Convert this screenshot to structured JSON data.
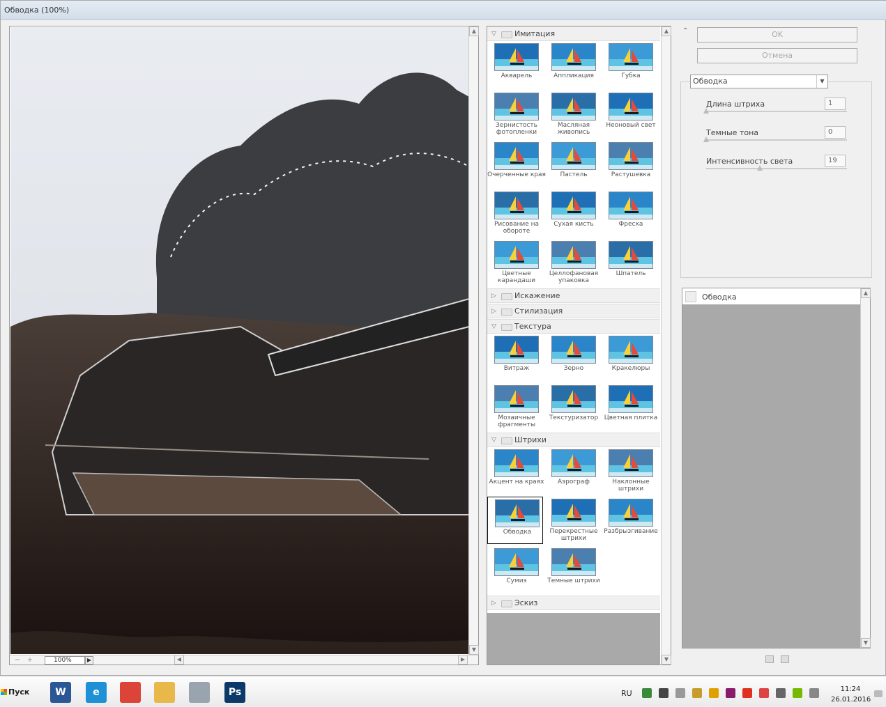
{
  "window": {
    "title": "Обводка (100%)"
  },
  "preview": {
    "zoom": "100%",
    "zoom_minus": "−",
    "zoom_plus": "+"
  },
  "gallery": {
    "categories": [
      {
        "name": "Имитация",
        "expanded": true,
        "filters": [
          "Акварель",
          "Аппликация",
          "Губка",
          "Зернистость фотопленки",
          "Масляная живопись",
          "Неоновый свет",
          "Очерченные края",
          "Пастель",
          "Растушевка",
          "Рисование на обороте",
          "Сухая кисть",
          "Фреска",
          "Цветные карандаши",
          "Целлофановая упаковка",
          "Шпатель"
        ]
      },
      {
        "name": "Искажение",
        "expanded": false,
        "filters": []
      },
      {
        "name": "Стилизация",
        "expanded": false,
        "filters": []
      },
      {
        "name": "Текстура",
        "expanded": true,
        "filters": [
          "Витраж",
          "Зерно",
          "Кракелюры",
          "Мозаичные фрагменты",
          "Текстуризатор",
          "Цветная плитка"
        ]
      },
      {
        "name": "Штрихи",
        "expanded": true,
        "filters": [
          "Акцент на краях",
          "Аэрограф",
          "Наклонные штрихи",
          "Обводка",
          "Перекрестные штрихи",
          "Разбрызгивание",
          "Сумиэ",
          "Темные штрихи"
        ]
      },
      {
        "name": "Эскиз",
        "expanded": false,
        "filters": []
      }
    ],
    "selected": "Обводка"
  },
  "buttons": {
    "ok": "OK",
    "cancel": "Отмена"
  },
  "settings": {
    "filter": "Обводка",
    "params": [
      {
        "label": "Длина штриха",
        "value": "1",
        "min": 1,
        "max": 50,
        "num": 1
      },
      {
        "label": "Темные тона",
        "value": "0",
        "min": 0,
        "max": 50,
        "num": 0
      },
      {
        "label": "Интенсивность света",
        "value": "19",
        "min": 0,
        "max": 50,
        "num": 19
      }
    ]
  },
  "layers": {
    "items": [
      "Обводка"
    ]
  },
  "taskbar": {
    "start": "Пуск",
    "apps": [
      {
        "name": "word",
        "label": "W",
        "color": "#2b5797"
      },
      {
        "name": "ie",
        "label": "e",
        "color": "#1e90d6"
      },
      {
        "name": "chrome",
        "label": "",
        "color": "#db4437"
      },
      {
        "name": "explorer",
        "label": "",
        "color": "#e8b94a"
      },
      {
        "name": "calculator",
        "label": "",
        "color": "#9aa4ae"
      },
      {
        "name": "photoshop",
        "label": "Ps",
        "color": "#0b3a69"
      }
    ],
    "lang": "RU",
    "time": "11:24",
    "date": "26.01.2016"
  }
}
